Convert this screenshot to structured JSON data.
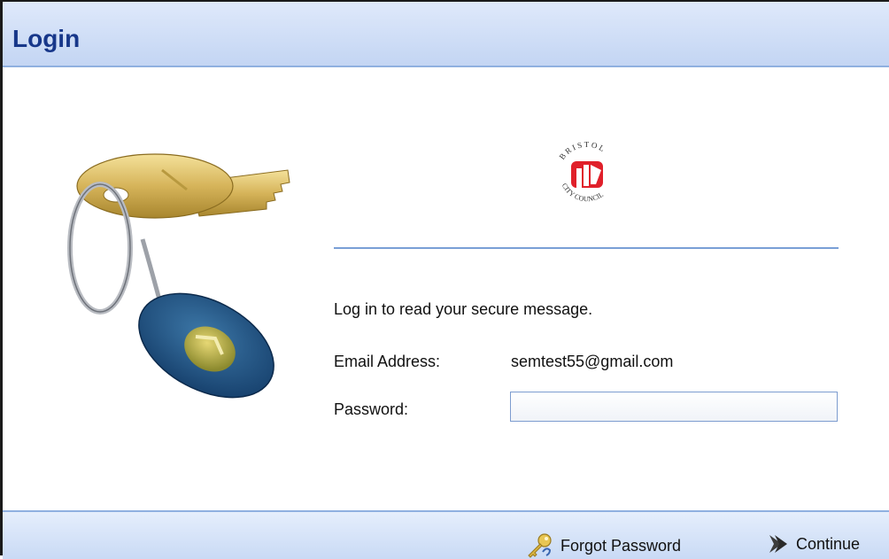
{
  "header": {
    "title": "Login"
  },
  "logo": {
    "name": "bristol-city-council-logo",
    "text": "BRISTOL CITY COUNCIL"
  },
  "form": {
    "intro": "Log in to read your secure message.",
    "email_label": "Email Address:",
    "email_value": "semtest55@gmail.com",
    "password_label": "Password:",
    "password_value": ""
  },
  "footer": {
    "forgot_label": "Forgot Password",
    "continue_label": "Continue"
  },
  "colors": {
    "title": "#17378a",
    "header_bg": "#c3d5f3",
    "rule": "#7a9fd6",
    "logo_red": "#e0202a"
  },
  "icons": {
    "key_illustration": "keyring-illustration",
    "forgot": "key-icon",
    "continue": "chevron-right-icon"
  }
}
